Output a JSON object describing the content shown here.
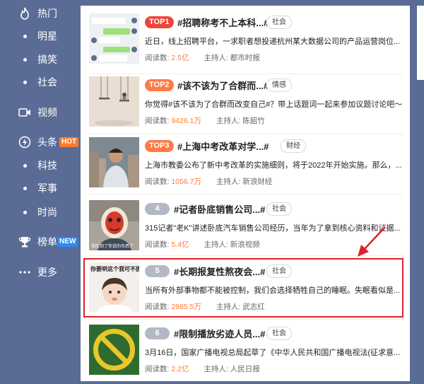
{
  "sidebar": {
    "items": [
      {
        "label": "热门",
        "icon": "flame-icon"
      },
      {
        "label": "明星"
      },
      {
        "label": "搞笑"
      },
      {
        "label": "社会"
      },
      {
        "label": "视频",
        "icon": "video-icon"
      },
      {
        "label": "头条",
        "icon": "lightning-icon",
        "badge": "HOT"
      },
      {
        "label": "科技"
      },
      {
        "label": "军事"
      },
      {
        "label": "时尚"
      },
      {
        "label": "榜单",
        "icon": "trophy-icon",
        "badge": "NEW"
      },
      {
        "label": "更多",
        "icon": "more-icon"
      }
    ]
  },
  "topics": [
    {
      "rank": "TOP1",
      "title": "#招聘称考不上本科...#",
      "tag": "社会",
      "desc": "近日，线上招聘平台，一求职者想投递杭州某大数据公司的产品运营岗位...",
      "reads_label": "阅读数:",
      "reads": "2.5亿",
      "host_label": "主持人:",
      "host": "都市时报"
    },
    {
      "rank": "TOP2",
      "title": "#该不该为了合群而...#",
      "tag": "情感",
      "desc": "你觉得#该不该为了合群而改变自己#？带上话题词一起来参加议题讨论吧～",
      "reads_label": "阅读数:",
      "reads": "9426.1万",
      "host_label": "主持人:",
      "host": "陈韶竹"
    },
    {
      "rank": "TOP3",
      "title": "#上海中考改革对学...#",
      "tag": "财经",
      "desc": "上海市教委公布了新中考改革的实施细则，将于2022年开始实施。那么，...",
      "reads_label": "阅读数:",
      "reads": "1056.7万",
      "host_label": "主持人:",
      "host": "新浪财经"
    },
    {
      "rank": "4",
      "title": "#记者卧底销售公司...#",
      "tag": "社会",
      "desc": "315记者\"老K\"讲述卧底汽车销售公司经历，当年为了拿到核心资料和证据...",
      "reads_label": "阅读数:",
      "reads": "5.4亿",
      "host_label": "主持人:",
      "host": "新浪视频",
      "thumb_caption": "我吃到了你说的东西了"
    },
    {
      "rank": "5",
      "title": "#长期报复性熬夜会...#",
      "tag": "社会",
      "desc": "当所有外部事物都不能被控制，我们会选择牺牲自己的睡眠。失眠看似是...",
      "reads_label": "阅读数:",
      "reads": "2985.5万",
      "host_label": "主持人:",
      "host": "武志红",
      "thumb_caption": "你要哄这个我可不困了"
    },
    {
      "rank": "6",
      "title": "#限制播放劣迹人员...#",
      "tag": "社会",
      "desc": "3月16日，国家广播电视总局起草了《中华人民共和国广播电视法(征求意...",
      "reads_label": "阅读数:",
      "reads": "2.2亿",
      "host_label": "主持人:",
      "host": "人民日报"
    }
  ],
  "colors": {
    "accent": "#ff7a2f",
    "top1": "#f0443a",
    "highlight": "#e0222a",
    "sidebar_bg": "#5a6c96"
  }
}
